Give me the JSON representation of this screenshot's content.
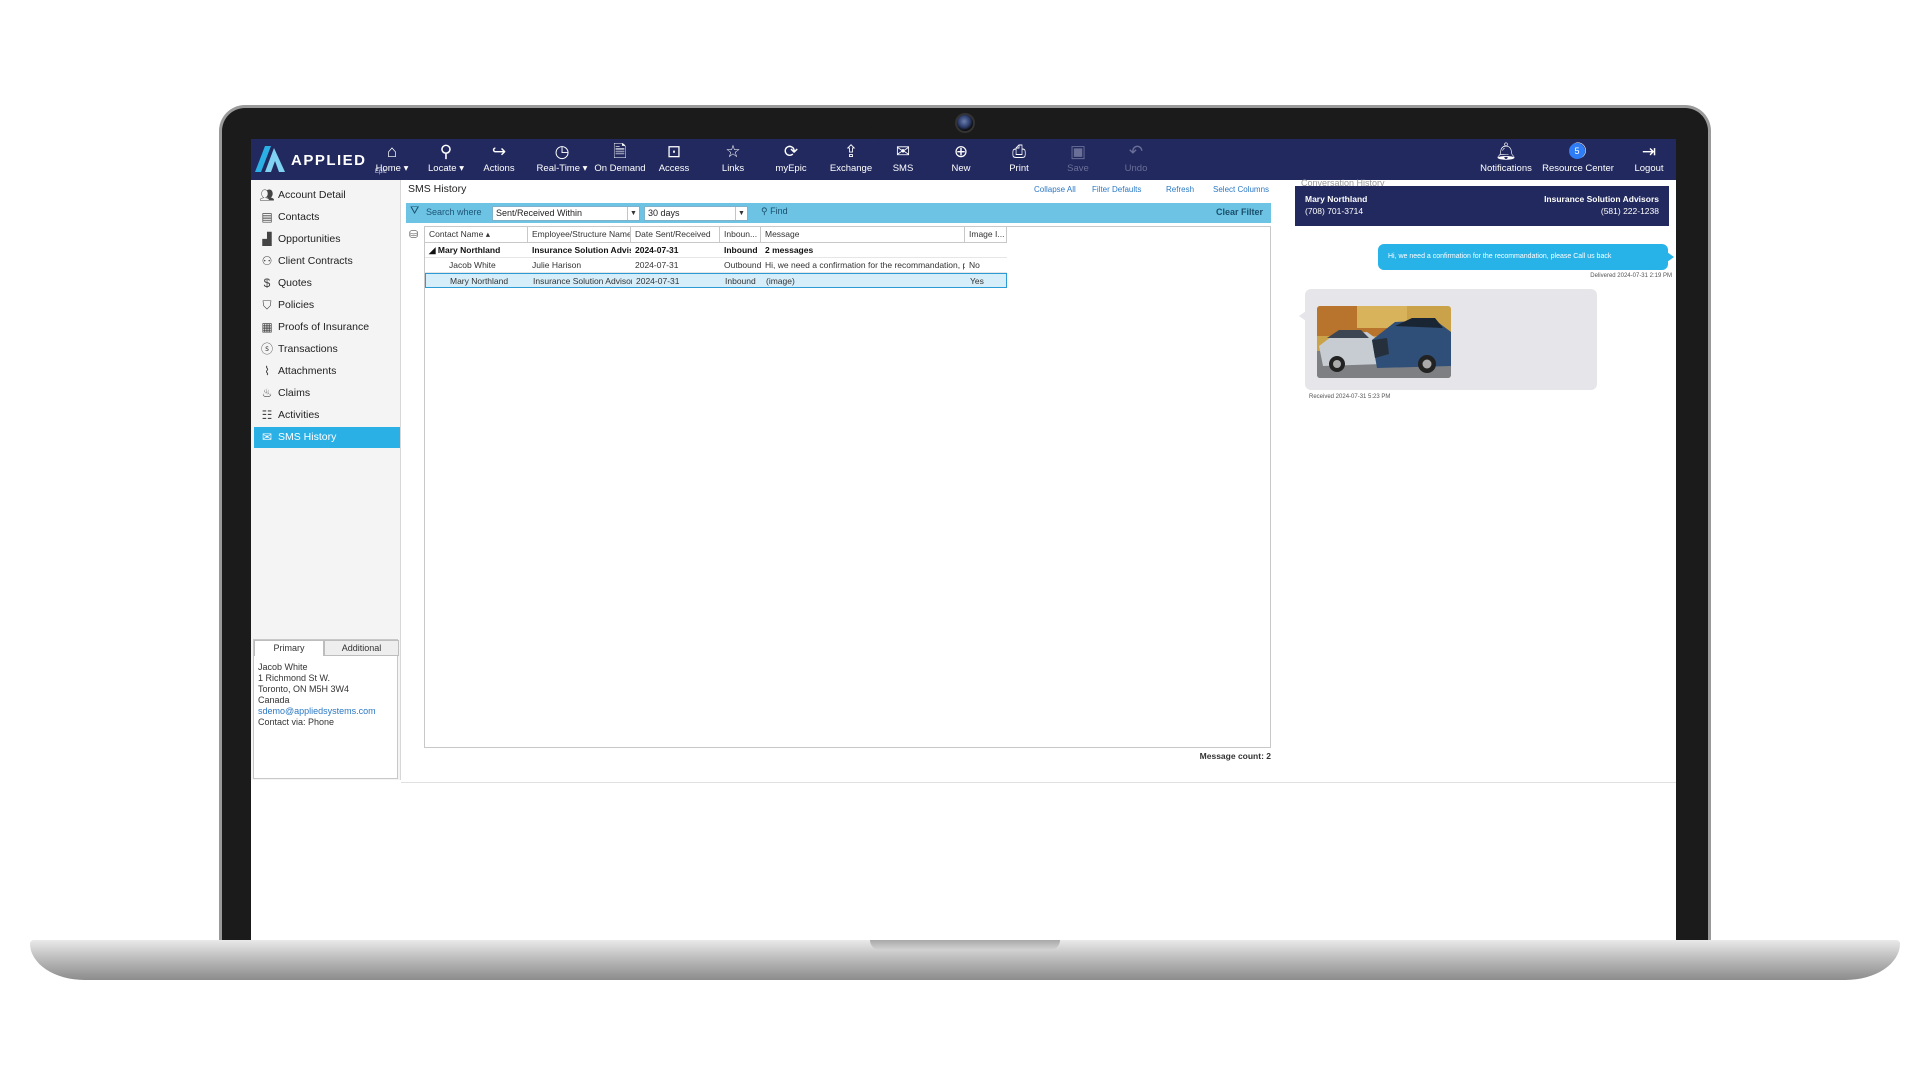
{
  "app": {
    "logo_text": "APPLIED",
    "logo_sub": "Epic"
  },
  "toolbar": [
    {
      "label": "Home",
      "icon": "home-icon",
      "dropdown": true
    },
    {
      "label": "Locate",
      "icon": "search-icon",
      "dropdown": true
    },
    {
      "label": "Actions",
      "icon": "share-icon"
    },
    {
      "label": "Real-Time",
      "icon": "clock-icon",
      "dropdown": true
    },
    {
      "label": "On Demand",
      "icon": "document-icon"
    },
    {
      "label": "Access",
      "icon": "access-icon"
    },
    {
      "label": "Links",
      "icon": "star-icon"
    },
    {
      "label": "myEpic",
      "icon": "refresh-icon"
    },
    {
      "label": "Exchange",
      "icon": "upload-icon"
    },
    {
      "label": "SMS",
      "icon": "sms-icon"
    },
    {
      "label": "New",
      "icon": "plus-icon"
    },
    {
      "label": "Print",
      "icon": "print-icon"
    },
    {
      "label": "Save",
      "icon": "save-icon",
      "disabled": true
    },
    {
      "label": "Undo",
      "icon": "undo-icon",
      "disabled": true
    }
  ],
  "toolbar_right": [
    {
      "label": "Notifications",
      "icon": "bell-icon"
    },
    {
      "label": "Resource Center",
      "icon": "help-icon",
      "badge": "5"
    },
    {
      "label": "Logout",
      "icon": "logout-icon"
    }
  ],
  "sidebar": {
    "items": [
      {
        "label": "Account Detail",
        "icon": "account-icon"
      },
      {
        "label": "Contacts",
        "icon": "contacts-icon"
      },
      {
        "label": "Opportunities",
        "icon": "chart-icon"
      },
      {
        "label": "Client Contracts",
        "icon": "handshake-icon"
      },
      {
        "label": "Quotes",
        "icon": "dollar-icon"
      },
      {
        "label": "Policies",
        "icon": "shield-icon"
      },
      {
        "label": "Proofs of Insurance",
        "icon": "certificate-icon"
      },
      {
        "label": "Transactions",
        "icon": "dollar-circle-icon"
      },
      {
        "label": "Attachments",
        "icon": "paperclip-icon"
      },
      {
        "label": "Claims",
        "icon": "fire-icon"
      },
      {
        "label": "Activities",
        "icon": "clipboard-icon"
      },
      {
        "label": "SMS History",
        "icon": "sms-history-icon",
        "active": true
      }
    ]
  },
  "contact_panel": {
    "tabs": [
      "Primary",
      "Additional"
    ],
    "name": "Jacob White",
    "address1": "1 Richmond St W.",
    "address2": "Toronto, ON  M5H 3W4",
    "country": "Canada",
    "email": "sdemo@appliedsystems.com",
    "contact_via": "Contact via: Phone"
  },
  "sms_history": {
    "title": "SMS History",
    "links": [
      "Collapse All",
      "Filter Defaults",
      "Refresh",
      "Select Columns"
    ],
    "filter": {
      "search_where_label": "Search where",
      "field": "Sent/Received Within",
      "value": "30 days",
      "find_label": "Find",
      "clear_label": "Clear Filter"
    },
    "columns": [
      "Contact Name",
      "Employee/Structure Name",
      "Date Sent/Received",
      "Inboun...",
      "Message",
      "Image I..."
    ],
    "rows": [
      {
        "type": "group",
        "cells": [
          "Mary Northland",
          "Insurance Solution Advis...",
          "2024-07-31",
          "Inbound",
          "2 messages",
          ""
        ]
      },
      {
        "type": "row",
        "cells": [
          "Jacob White",
          "Julie Harison",
          "2024-07-31",
          "Outbound",
          "Hi, we need a confirmation for the recommandation, plea...",
          "No"
        ]
      },
      {
        "type": "row",
        "selected": true,
        "cells": [
          "Mary Northland",
          "Insurance Solution Advisors",
          "2024-07-31",
          "Inbound",
          "(image)",
          "Yes"
        ]
      }
    ],
    "message_count": "Message count: 2"
  },
  "conversation": {
    "title": "Conversation History",
    "contact_name": "Mary Northland",
    "contact_phone": "(708) 701-3714",
    "org_name": "Insurance Solution Advisors",
    "org_phone": "(581) 222-1238",
    "outgoing_text": "Hi, we need a confirmation for the recommandation, please Call us back",
    "outgoing_status": "Delivered 2024-07-31 2:19 PM",
    "incoming_status": "Received 2024-07-31 5:23 PM",
    "incoming_image": "car-accident-photo"
  },
  "colors": {
    "topbar": "#22295e",
    "accent": "#2bb0e6",
    "filterbar": "#6cc3e3",
    "bubble_out": "#27b2e8",
    "bubble_in": "#e6e6ea"
  }
}
